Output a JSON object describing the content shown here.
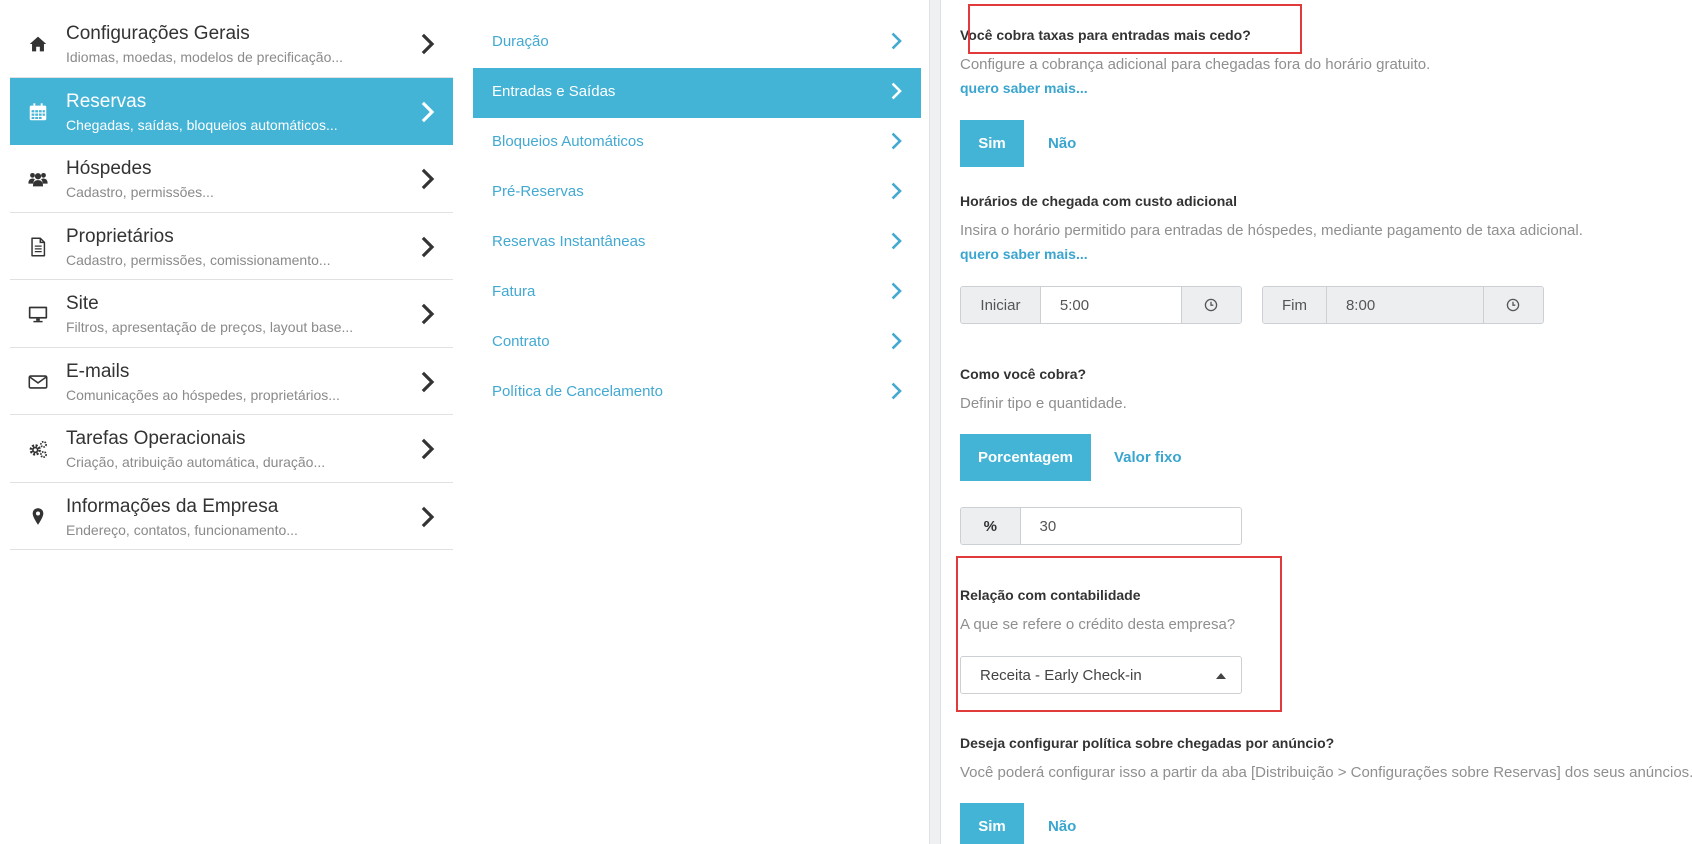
{
  "menu": {
    "items": [
      {
        "title": "Configurações Gerais",
        "subtitle": "Idiomas, moedas, modelos de precificação...",
        "icon": "home-icon"
      },
      {
        "title": "Reservas",
        "subtitle": "Chegadas, saídas, bloqueios automáticos...",
        "icon": "calendar-icon",
        "active": true
      },
      {
        "title": "Hóspedes",
        "subtitle": "Cadastro, permissões...",
        "icon": "users-icon"
      },
      {
        "title": "Proprietários",
        "subtitle": "Cadastro, permissões, comissionamento...",
        "icon": "document-icon"
      },
      {
        "title": "Site",
        "subtitle": "Filtros, apresentação de preços, layout base...",
        "icon": "monitor-icon"
      },
      {
        "title": "E-mails",
        "subtitle": "Comunicações ao hóspedes, proprietários...",
        "icon": "envelope-icon"
      },
      {
        "title": "Tarefas Operacionais",
        "subtitle": "Criação, atribuição automática, duração...",
        "icon": "gears-icon"
      },
      {
        "title": "Informações da Empresa",
        "subtitle": "Endereço, contatos, funcionamento...",
        "icon": "map-pin-icon"
      }
    ]
  },
  "submenu": {
    "items": [
      {
        "label": "Duração"
      },
      {
        "label": "Entradas e Saídas",
        "active": true
      },
      {
        "label": "Bloqueios Automáticos"
      },
      {
        "label": "Pré-Reservas"
      },
      {
        "label": "Reservas Instantâneas"
      },
      {
        "label": "Fatura"
      },
      {
        "label": "Contrato"
      },
      {
        "label": "Política de Cancelamento"
      }
    ]
  },
  "early_fee": {
    "title": "Você cobra taxas para entradas mais cedo?",
    "description": "Configure a cobrança adicional para chegadas fora do horário gratuito.",
    "link": "quero saber mais...",
    "yes": "Sim",
    "no": "Não",
    "selected": "Sim"
  },
  "arrival_times": {
    "title": "Horários de chegada com custo adicional",
    "description": "Insira o horário permitido para entradas de hóspedes, mediante pagamento de taxa adicional.",
    "link": "quero saber mais...",
    "start_label": "Iniciar",
    "start_value": "5:00",
    "end_label": "Fim",
    "end_value": "8:00"
  },
  "charge": {
    "title": "Como você cobra?",
    "description": "Definir tipo e quantidade.",
    "option_percent": "Porcentagem",
    "option_fixed": "Valor fixo",
    "selected": "Porcentagem",
    "unit": "%",
    "value": "30"
  },
  "accounting": {
    "title": "Relação com contabilidade",
    "description": "A que se refere o crédito desta empresa?",
    "selected": "Receita - Early Check-in"
  },
  "listing_policy": {
    "title": "Deseja configurar política sobre chegadas por anúncio?",
    "description": "Você poderá configurar isso a partir da aba [Distribuição > Configurações sobre Reservas] dos seus anúncios.",
    "yes": "Sim",
    "no": "Não",
    "selected": "Sim"
  },
  "colors": {
    "accent": "#43b3d6",
    "link": "#3aa5cf",
    "highlight": "#e03a3a"
  }
}
